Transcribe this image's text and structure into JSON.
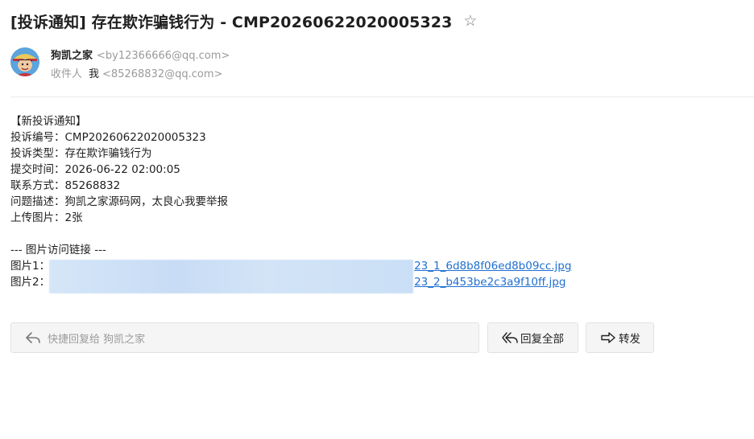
{
  "email": {
    "subject": "[投诉通知] 存在欺诈骗钱行为 - CMP20260622020005323",
    "star_icon": "☆",
    "sender": {
      "name": "狗凯之家",
      "email": "<by12366666@qq.com>"
    },
    "recipient": {
      "label": "收件人",
      "name": "我",
      "email": "<85268832@qq.com>"
    },
    "body": {
      "lines": [
        "【新投诉通知】",
        "投诉编号：CMP20260622020005323",
        "投诉类型：存在欺诈骗钱行为",
        "提交时间：2026-06-22 02:00:05",
        "联系方式：85268832",
        "问题描述：狗凯之家源码网，太良心我要举报",
        "上传图片：2张"
      ],
      "links_header": "--- 图片访问链接 ---",
      "links": [
        {
          "label": "图片1：",
          "url_visible": "23_1_6d8b8f06ed8b09cc.jpg"
        },
        {
          "label": "图片2：",
          "url_visible": "23_2_b453be2c3a9f10ff.jpg"
        }
      ]
    }
  },
  "actions": {
    "quick_reply_placeholder": "快捷回复给 狗凯之家",
    "reply_all_label": "回复全部",
    "forward_label": "转发"
  },
  "colors": {
    "link": "#1f6fd1",
    "muted": "#9a9a9a",
    "button_bg": "#f5f5f5"
  }
}
